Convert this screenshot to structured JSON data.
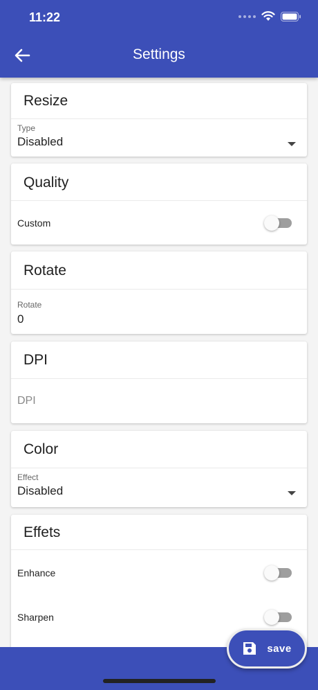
{
  "status_bar": {
    "time": "11:22"
  },
  "header": {
    "title": "Settings"
  },
  "sections": {
    "resize": {
      "title": "Resize",
      "type_label": "Type",
      "type_value": "Disabled"
    },
    "quality": {
      "title": "Quality",
      "custom_label": "Custom",
      "custom_on": false
    },
    "rotate": {
      "title": "Rotate",
      "rotate_label": "Rotate",
      "rotate_value": "0"
    },
    "dpi": {
      "title": "DPI",
      "dpi_placeholder": "DPI"
    },
    "color": {
      "title": "Color",
      "effect_label": "Effect",
      "effect_value": "Disabled"
    },
    "effects": {
      "title": "Effets",
      "enhance_label": "Enhance",
      "enhance_on": false,
      "sharpen_label": "Sharpen",
      "sharpen_on": false
    }
  },
  "fab": {
    "label": "save",
    "icon": "save-icon"
  },
  "colors": {
    "primary": "#3c4fb8",
    "background": "#f4f4f4",
    "switch_track": "#9e9e9e"
  }
}
